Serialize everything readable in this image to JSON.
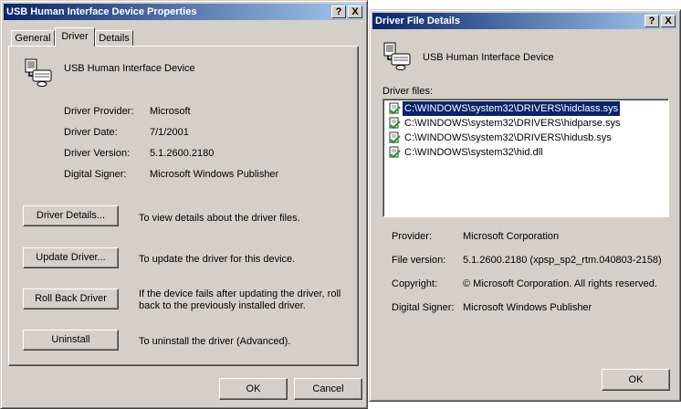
{
  "props": {
    "title": "USB Human Interface Device Properties",
    "help_btn": "?",
    "close_btn": "X",
    "tabs": [
      "General",
      "Driver",
      "Details"
    ],
    "device_name": "USB Human Interface Device",
    "info": [
      {
        "label": "Driver Provider:",
        "value": "Microsoft"
      },
      {
        "label": "Driver Date:",
        "value": "7/1/2001"
      },
      {
        "label": "Driver Version:",
        "value": "5.1.2600.2180"
      },
      {
        "label": "Digital Signer:",
        "value": "Microsoft Windows Publisher"
      }
    ],
    "actions": [
      {
        "button": "Driver Details...",
        "desc": "To view details about the driver files."
      },
      {
        "button": "Update Driver...",
        "desc": "To update the driver for this device."
      },
      {
        "button": "Roll Back Driver",
        "desc": "If the device fails after updating the driver, roll",
        "desc2": "back to the previously installed driver."
      },
      {
        "button": "Uninstall",
        "desc": "To uninstall the driver (Advanced)."
      }
    ],
    "ok": "OK",
    "cancel": "Cancel"
  },
  "details": {
    "title": "Driver File Details",
    "help_btn": "?",
    "close_btn": "X",
    "device_name": "USB Human Interface Device",
    "files_label": "Driver files:",
    "files": [
      "C:\\WINDOWS\\system32\\DRIVERS\\hidclass.sys",
      "C:\\WINDOWS\\system32\\DRIVERS\\hidparse.sys",
      "C:\\WINDOWS\\system32\\DRIVERS\\hidusb.sys",
      "C:\\WINDOWS\\system32\\hid.dll"
    ],
    "selected_file_index": 0,
    "info": [
      {
        "label": "Provider:",
        "value": "Microsoft Corporation"
      },
      {
        "label": "File version:",
        "value": "5.1.2600.2180 (xpsp_sp2_rtm.040803-2158)"
      },
      {
        "label": "Copyright:",
        "value": "© Microsoft Corporation. All rights reserved."
      },
      {
        "label": "Digital Signer:",
        "value": "Microsoft Windows Publisher"
      }
    ],
    "ok": "OK"
  },
  "colors": {
    "title_active_start": "#0a246a",
    "title_active_end": "#a6caf0",
    "window_face": "#d4d0c8",
    "selection": "#0a246a"
  }
}
